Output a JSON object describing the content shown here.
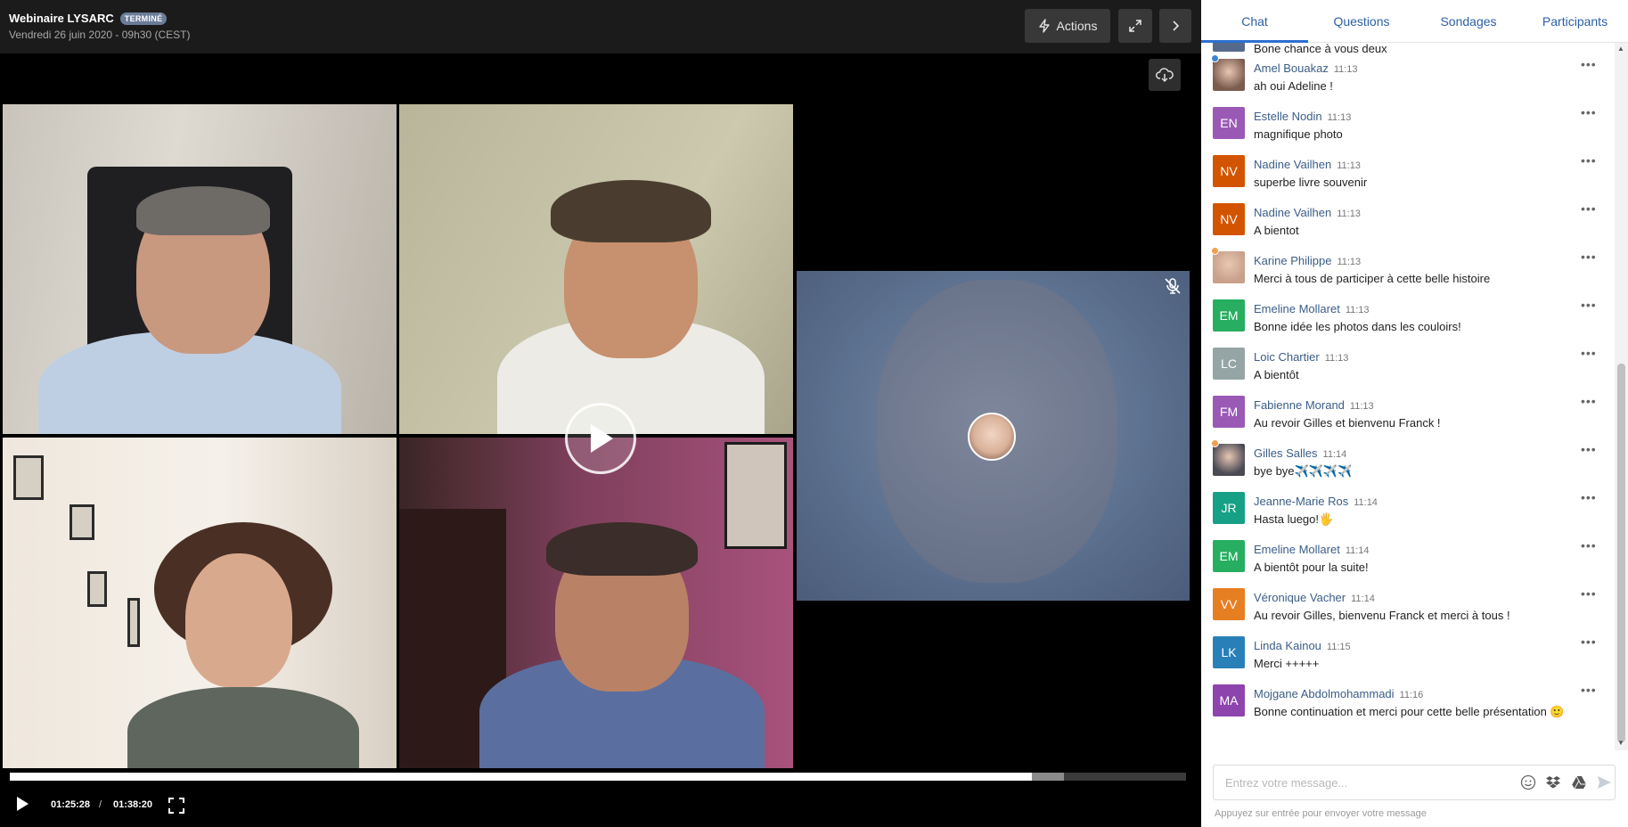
{
  "header": {
    "title": "Webinaire LYSARC",
    "status_badge": "TERMINÉ",
    "date": "Vendredi 26 juin 2020 - 09h30 (CEST)",
    "actions_label": "Actions",
    "icons": [
      "bolt-icon",
      "expand-icon",
      "chevron-right-icon",
      "cloud-download-icon"
    ]
  },
  "player": {
    "current_time": "01:25:28",
    "separator": "/",
    "total_time": "01:38:20",
    "progress_fraction": 0.869,
    "buffered_fraction": 0.896
  },
  "tabs": [
    {
      "label": "Chat",
      "active": true
    },
    {
      "label": "Questions",
      "active": false
    },
    {
      "label": "Sondages",
      "active": false
    },
    {
      "label": "Participants",
      "active": false
    }
  ],
  "chat": {
    "partial_top_text": "Bone chance à vous deux",
    "messages": [
      {
        "name": "Amel Bouakaz",
        "time": "11:13",
        "text": "ah oui Adeline !",
        "initials": "",
        "color": "#7a5c4e",
        "photo": true,
        "dot": "#3a86d4"
      },
      {
        "name": "Estelle Nodin",
        "time": "11:13",
        "text": "magnifique photo",
        "initials": "EN",
        "color": "#9b59b6",
        "photo": false,
        "dot": ""
      },
      {
        "name": "Nadine Vailhen",
        "time": "11:13",
        "text": "superbe livre souvenir",
        "initials": "NV",
        "color": "#d35400",
        "photo": false,
        "dot": ""
      },
      {
        "name": "Nadine Vailhen",
        "time": "11:13",
        "text": "A bientot",
        "initials": "NV",
        "color": "#d35400",
        "photo": false,
        "dot": ""
      },
      {
        "name": "Karine Philippe",
        "time": "11:13",
        "text": "Merci à tous de participer à cette belle histoire",
        "initials": "",
        "color": "#c9a08a",
        "photo": true,
        "dot": "#f0a04b"
      },
      {
        "name": "Emeline Mollaret",
        "time": "11:13",
        "text": "Bonne idée les photos dans les couloirs!",
        "initials": "EM",
        "color": "#27ae60",
        "photo": false,
        "dot": ""
      },
      {
        "name": "Loic Chartier",
        "time": "11:13",
        "text": "A bientôt",
        "initials": "LC",
        "color": "#95a5a6",
        "photo": false,
        "dot": ""
      },
      {
        "name": "Fabienne Morand",
        "time": "11:13",
        "text": "Au revoir Gilles et bienvenu Franck !",
        "initials": "FM",
        "color": "#9b59b6",
        "photo": false,
        "dot": ""
      },
      {
        "name": "Gilles Salles",
        "time": "11:14",
        "text": "bye bye✈️✈️✈️✈️",
        "initials": "",
        "color": "#4a4a55",
        "photo": true,
        "dot": "#f0a04b"
      },
      {
        "name": "Jeanne-Marie Ros",
        "time": "11:14",
        "text": "Hasta luego!🖐️",
        "initials": "JR",
        "color": "#16a085",
        "photo": false,
        "dot": ""
      },
      {
        "name": "Emeline Mollaret",
        "time": "11:14",
        "text": "A bientôt pour la suite!",
        "initials": "EM",
        "color": "#27ae60",
        "photo": false,
        "dot": ""
      },
      {
        "name": "Véronique Vacher",
        "time": "11:14",
        "text": "Au revoir Gilles, bienvenu Franck et merci à tous !",
        "initials": "VV",
        "color": "#e67e22",
        "photo": false,
        "dot": ""
      },
      {
        "name": "Linda Kainou",
        "time": "11:15",
        "text": "Merci +++++",
        "initials": "LK",
        "color": "#2980b9",
        "photo": false,
        "dot": ""
      },
      {
        "name": "Mojgane Abdolmohammadi",
        "time": "11:16",
        "text": "Bonne continuation et merci pour cette belle présentation 🙂",
        "initials": "MA",
        "color": "#8e44ad",
        "photo": false,
        "dot": ""
      }
    ],
    "more_label": "•••"
  },
  "composer": {
    "placeholder": "Entrez votre message...",
    "hint": "Appuyez sur entrée pour envoyer votre message",
    "icons": [
      "emoji-icon",
      "dropbox-icon",
      "google-drive-icon",
      "send-icon"
    ]
  },
  "colors": {
    "accent": "#2c6fd0",
    "tab_text": "#2c5fa6",
    "name_text": "#3b5d86",
    "badge": "#6b7c99"
  }
}
